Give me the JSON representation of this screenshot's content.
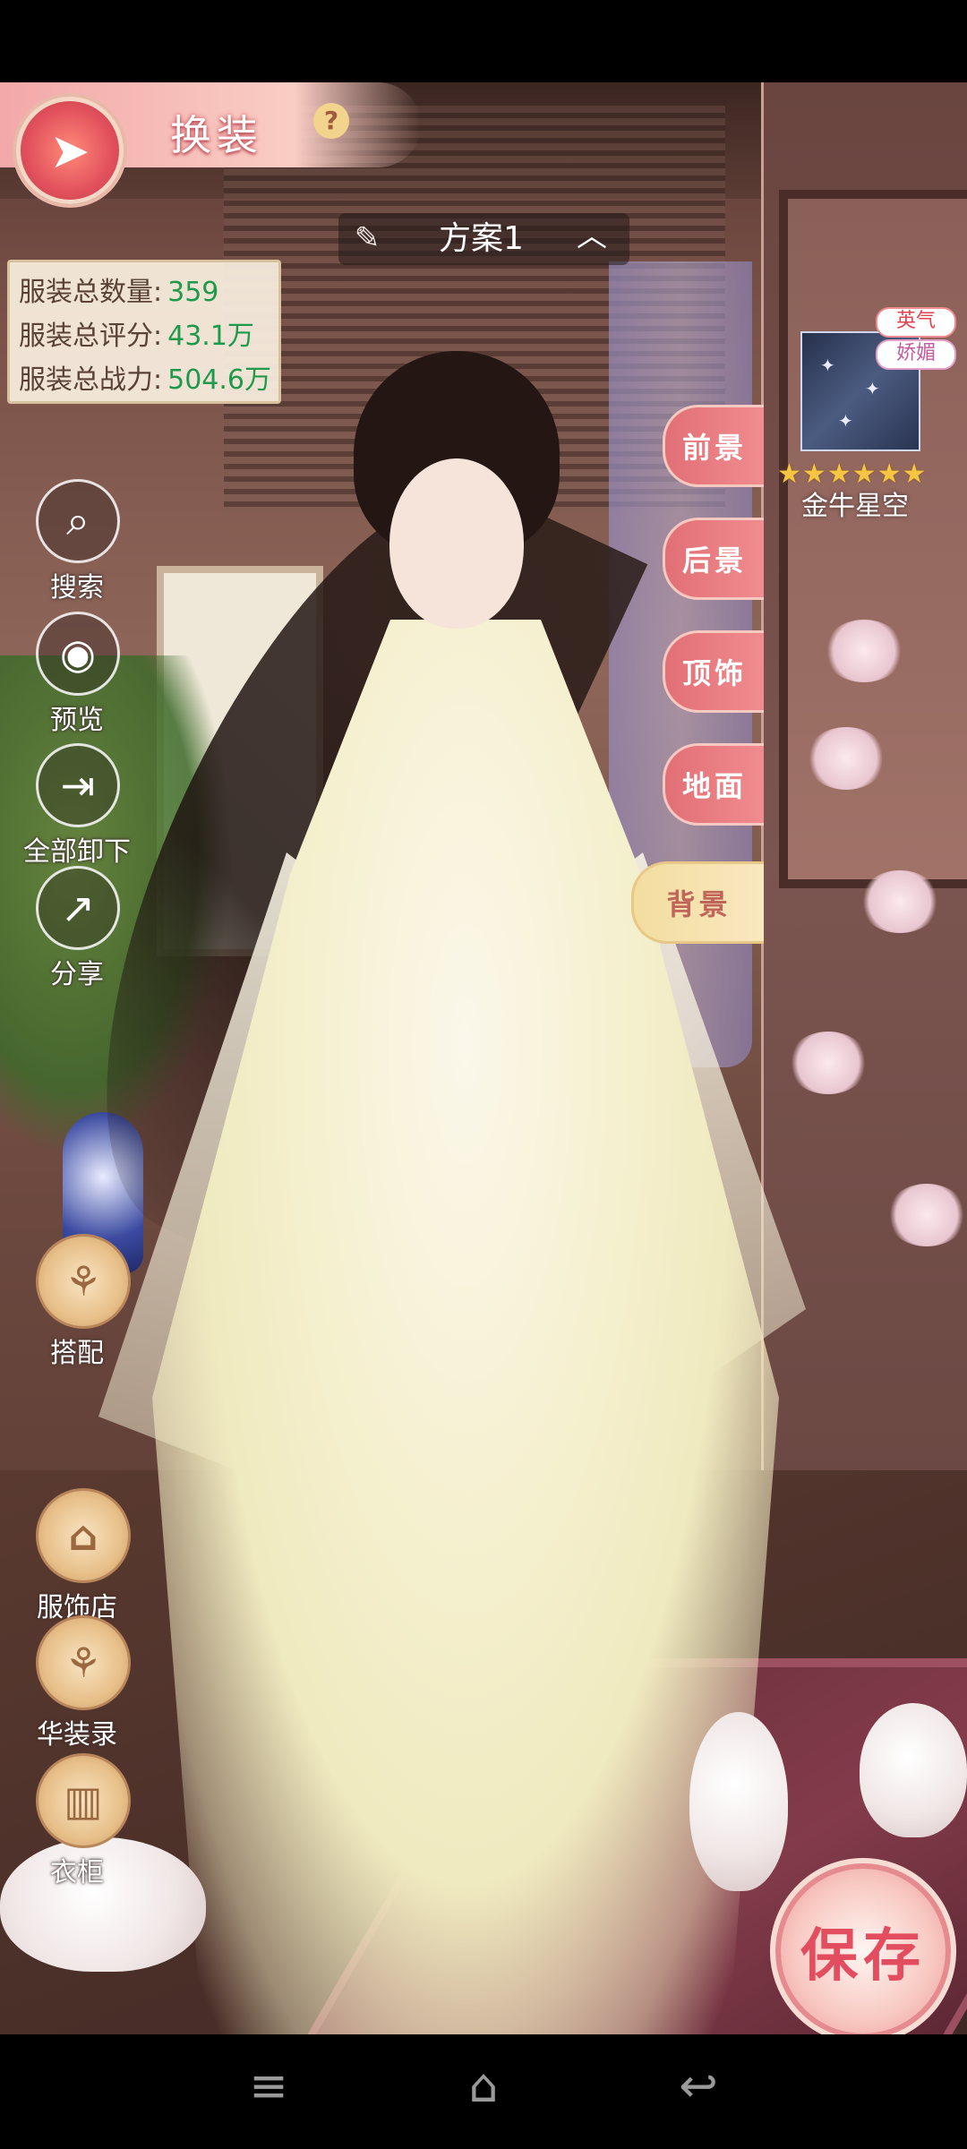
{
  "header": {
    "title": "换装",
    "help_icon": "?",
    "logo_icon": "swallow-emblem"
  },
  "scheme": {
    "name": "方案1",
    "edit_icon": "edit-pencil",
    "up_icon": "chevron-up"
  },
  "stats": {
    "count_label": "服装总数量:",
    "count_value": "359",
    "score_label": "服装总评分:",
    "score_value": "43.1万",
    "power_label": "服装总战力:",
    "power_value": "504.6万"
  },
  "left_menu": {
    "search": "搜索",
    "preview": "预览",
    "remove_all": "全部卸下",
    "share": "分享",
    "match": "搭配",
    "shop": "服饰店",
    "gallery": "华装录",
    "wardrobe": "衣柜"
  },
  "layer_tabs": [
    "前景",
    "后景",
    "顶饰",
    "地面",
    "背景"
  ],
  "active_tab": "背景",
  "background_item": {
    "tags": [
      "英气",
      "娇媚"
    ],
    "stars": 6,
    "stars_text": "★★★★★★",
    "name": "金牛星空"
  },
  "save_button": "保存",
  "colors": {
    "accent_pink": "#e26f76",
    "active_gold": "#f3dd9f",
    "stat_green": "#1f9a4b"
  }
}
